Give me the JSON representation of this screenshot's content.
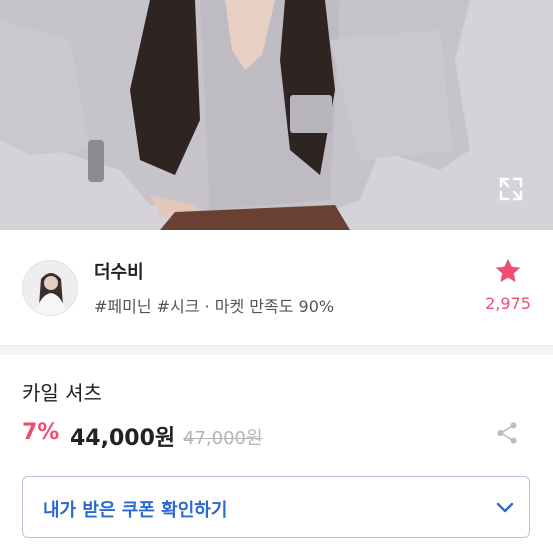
{
  "store": {
    "name": "더수비",
    "tags": "#페미닌 #시크 · 마켓 만족도 90%",
    "favorite_count": "2,975"
  },
  "product": {
    "name": "카일 셔츠",
    "discount": "7%",
    "price": "44,000원",
    "original_price": "47,000원"
  },
  "coupon": {
    "label": "내가 받은 쿠폰 확인하기"
  },
  "icons": {
    "expand": "expand-icon",
    "favorite": "star-icon",
    "share": "share-icon",
    "chevron": "chevron-down-icon"
  },
  "colors": {
    "accent_pink": "#f04e6f",
    "coupon_blue": "#2c6ad1"
  }
}
